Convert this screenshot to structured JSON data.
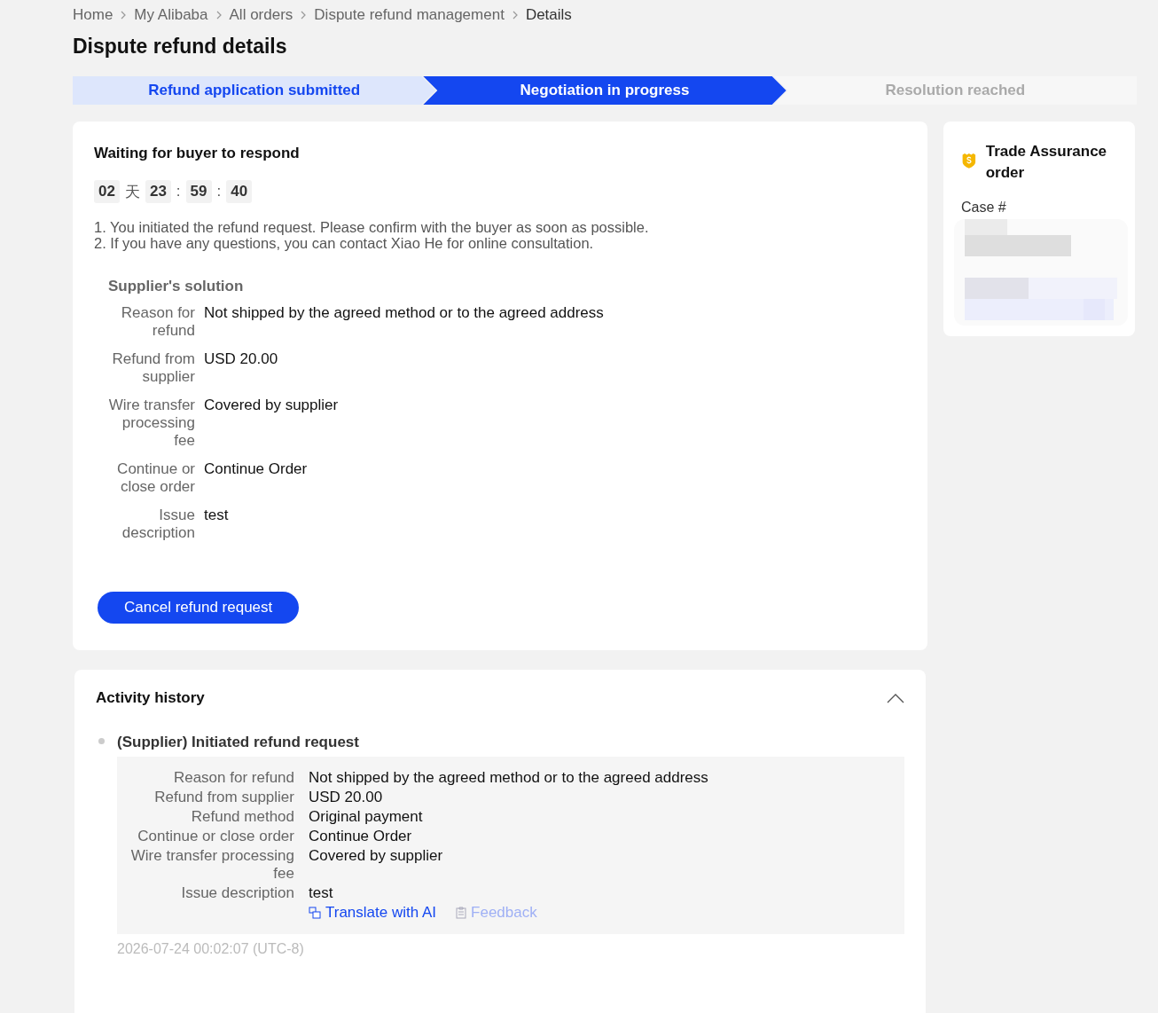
{
  "breadcrumb": [
    {
      "label": "Home",
      "current": false
    },
    {
      "label": "My Alibaba",
      "current": false
    },
    {
      "label": "All orders",
      "current": false
    },
    {
      "label": "Dispute refund management",
      "current": false
    },
    {
      "label": "Details",
      "current": true
    }
  ],
  "title": "Dispute refund details",
  "steps": [
    {
      "label": "Refund application submitted",
      "done": true,
      "selected": false
    },
    {
      "label": "Negotiation in progress",
      "done": false,
      "selected": true
    },
    {
      "label": "Resolution reached",
      "done": false,
      "selected": false
    }
  ],
  "status_card": {
    "heading": "Waiting for buyer to respond",
    "countdown": [
      {
        "kind": "digit",
        "text": "02"
      },
      {
        "kind": "unit",
        "text": "天"
      },
      {
        "kind": "digit",
        "text": "23"
      },
      {
        "kind": "unit",
        "text": ":"
      },
      {
        "kind": "digit",
        "text": "59"
      },
      {
        "kind": "unit",
        "text": ":"
      },
      {
        "kind": "digit",
        "text": "40"
      }
    ],
    "notes": [
      "1. You initiated the refund request. Please confirm with the buyer as soon as possible.",
      "2. If you have any questions, you can contact Xiao He for online consultation."
    ],
    "solution_title": "Supplier's solution",
    "fields": [
      {
        "label": "Reason for refund",
        "value": "Not shipped by the agreed method or to the agreed address"
      },
      {
        "label": "Refund from supplier",
        "value": "USD 20.00"
      },
      {
        "label": "Wire transfer processing fee",
        "value": "Covered by supplier"
      },
      {
        "label": "Continue or close order",
        "value": "Continue Order"
      },
      {
        "label": "Issue description",
        "value": "test"
      }
    ],
    "button": "Cancel refund request"
  },
  "side_card": {
    "title": "Trade Assurance order",
    "case_label": "Case #"
  },
  "activity": {
    "title": "Activity history",
    "expanded": true,
    "entries": [
      {
        "title": "(Supplier) Initiated refund request",
        "fields": [
          {
            "label": "Reason for refund",
            "value": "Not shipped by the agreed method or to the agreed address"
          },
          {
            "label": "Refund from supplier",
            "value": "USD 20.00"
          },
          {
            "label": "Refund method",
            "value": "Original payment"
          },
          {
            "label": "Continue or close order",
            "value": "Continue Order"
          },
          {
            "label": "Wire transfer processing fee",
            "value": "Covered by supplier"
          },
          {
            "label": "Issue description",
            "value": "test"
          }
        ],
        "translate": "Translate with AI",
        "feedback": "Feedback",
        "time": "2026-07-24 00:02:07 (UTC-8)"
      }
    ]
  }
}
